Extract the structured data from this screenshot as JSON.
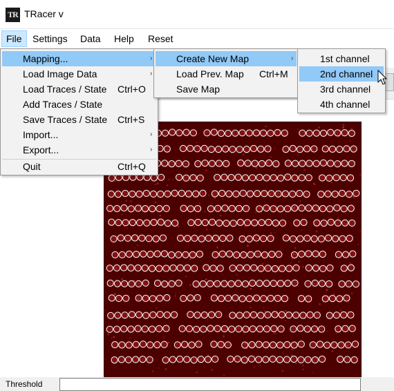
{
  "window": {
    "title": "TRacer v",
    "icon_text": "TR"
  },
  "menubar": [
    "File",
    "Settings",
    "Data",
    "Help",
    "Reset"
  ],
  "file_menu": {
    "items": [
      {
        "label": "Mapping...",
        "shortcut": "",
        "submenu": true,
        "highlighted": true
      },
      {
        "label": "Load Image Data",
        "shortcut": "",
        "submenu": true
      },
      {
        "label": "Load Traces / State",
        "shortcut": "Ctrl+O"
      },
      {
        "label": "Add Traces / State",
        "shortcut": ""
      },
      {
        "label": "Save Traces / State",
        "shortcut": "Ctrl+S"
      },
      {
        "label": "Import...",
        "shortcut": "",
        "submenu": true
      },
      {
        "label": "Export...",
        "shortcut": "",
        "submenu": true
      },
      {
        "label": "Quit",
        "shortcut": "Ctrl+Q"
      }
    ]
  },
  "mapping_menu": {
    "items": [
      {
        "label": "Create New Map",
        "shortcut": "",
        "submenu": true,
        "highlighted": true
      },
      {
        "label": "Load Prev. Map",
        "shortcut": "Ctrl+M"
      },
      {
        "label": "Save Map",
        "shortcut": ""
      }
    ]
  },
  "create_map_menu": {
    "items": [
      {
        "label": "1st channel"
      },
      {
        "label": "2nd channel",
        "highlighted": true
      },
      {
        "label": "3rd channel"
      },
      {
        "label": "4th channel"
      }
    ]
  },
  "statusbar": {
    "threshold_label": "Threshold",
    "threshold_value": ""
  },
  "colors": {
    "image_background": "#4d0000",
    "spot_color": "#ffffff",
    "menu_highlight": "#91c9f7",
    "menubar_active": "#cce8ff"
  }
}
